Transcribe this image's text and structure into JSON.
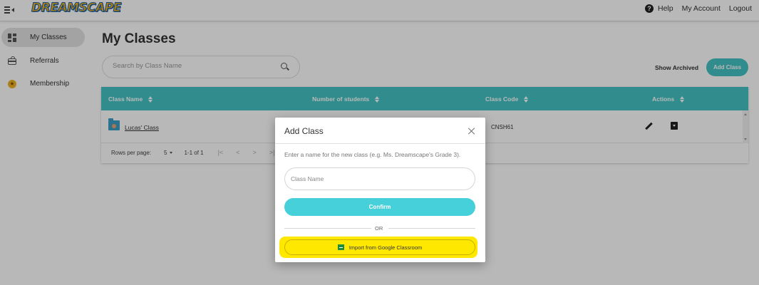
{
  "header": {
    "logo_text": "DREAMSCAPE",
    "help": "Help",
    "my_account": "My Account",
    "logout": "Logout"
  },
  "sidebar": {
    "items": [
      {
        "label": "My Classes",
        "icon": "grid-icon",
        "active": true
      },
      {
        "label": "Referrals",
        "icon": "gift-icon",
        "active": false
      },
      {
        "label": "Membership",
        "icon": "star-icon",
        "active": false
      }
    ]
  },
  "main": {
    "title": "My Classes",
    "search_placeholder": "Search by Class Name",
    "show_archived": "Show Archived",
    "add_class": "Add Class"
  },
  "table": {
    "columns": [
      "Class Name",
      "Number of students",
      "Class Code",
      "Actions"
    ],
    "rows": [
      {
        "class_name": "Lucas' Class",
        "students": "",
        "class_code": "CNSH61"
      }
    ],
    "rows_per_page_label": "Rows per page:",
    "rows_per_page_value": "5",
    "page_info": "1-1 of 1"
  },
  "modal": {
    "title": "Add Class",
    "description": "Enter a name for the new class (e.g. Ms. Dreamscape's Grade 3).",
    "input_placeholder": "Class Name",
    "confirm": "Confirm",
    "or": "OR",
    "google_import": "Import from Google Classroom"
  },
  "colors": {
    "accent": "#45c3c4",
    "confirm": "#45d0da",
    "highlight": "#ffe800"
  }
}
